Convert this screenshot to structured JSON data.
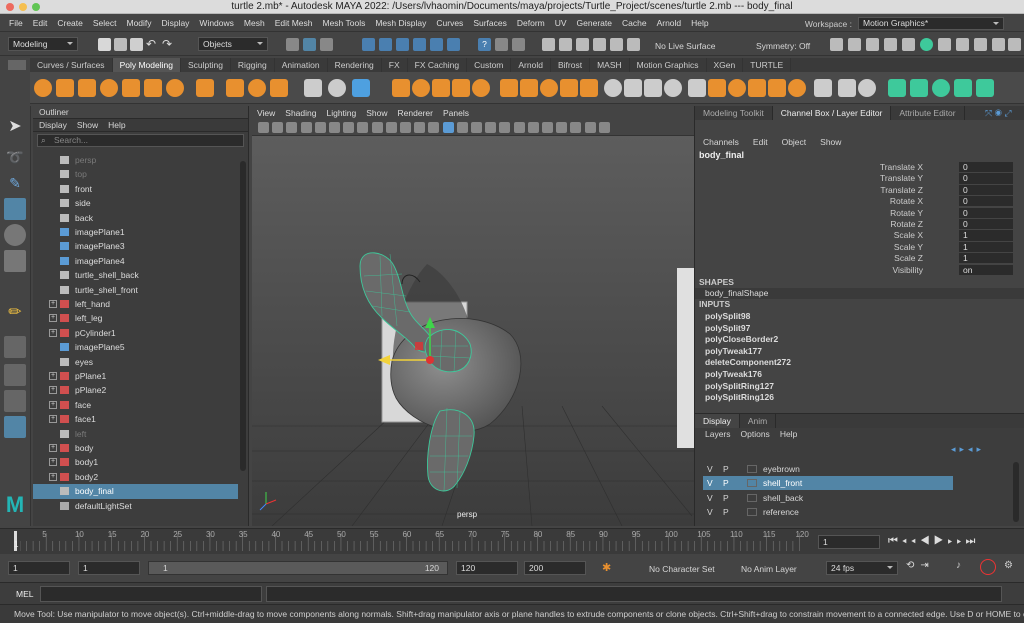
{
  "window": {
    "title": "turtle 2.mb* - Autodesk MAYA 2022: /Users/lvhaomin/Documents/maya/projects/Turtle_Project/scenes/turtle 2.mb   ---   body_final"
  },
  "menubar": [
    "File",
    "Edit",
    "Create",
    "Select",
    "Modify",
    "Display",
    "Windows",
    "Mesh",
    "Edit Mesh",
    "Mesh Tools",
    "Mesh Display",
    "Curves",
    "Surfaces",
    "Deform",
    "UV",
    "Generate",
    "Cache",
    "Arnold",
    "Help"
  ],
  "workspace": {
    "label": "Workspace :",
    "value": "Motion Graphics*"
  },
  "statusline": {
    "mode": "Modeling",
    "objects": "Objects",
    "live": "No Live Surface",
    "symmetry": "Symmetry: Off"
  },
  "shelf_tabs": [
    "Curves / Surfaces",
    "Poly Modeling",
    "Sculpting",
    "Rigging",
    "Animation",
    "Rendering",
    "FX",
    "FX Caching",
    "Custom",
    "Arnold",
    "Bifrost",
    "MASH",
    "Motion Graphics",
    "XGen",
    "TURTLE"
  ],
  "shelf_active": "Poly Modeling",
  "outliner": {
    "title": "Outliner",
    "menu": [
      "Display",
      "Show",
      "Help"
    ],
    "search_placeholder": "Search...",
    "items": [
      {
        "label": "persp",
        "icon": "camera",
        "dim": true
      },
      {
        "label": "top",
        "icon": "camera",
        "dim": true
      },
      {
        "label": "front",
        "icon": "camera"
      },
      {
        "label": "side",
        "icon": "camera"
      },
      {
        "label": "back",
        "icon": "camera"
      },
      {
        "label": "imagePlane1",
        "icon": "image-plane"
      },
      {
        "label": "imagePlane3",
        "icon": "image-plane"
      },
      {
        "label": "imagePlane4",
        "icon": "image-plane"
      },
      {
        "label": "turtle_shell_back",
        "icon": "transform"
      },
      {
        "label": "turtle_shell_front",
        "icon": "transform"
      },
      {
        "label": "left_hand",
        "icon": "mesh",
        "expand": true
      },
      {
        "label": "left_leg",
        "icon": "mesh",
        "expand": true
      },
      {
        "label": "pCylinder1",
        "icon": "mesh",
        "expand": true
      },
      {
        "label": "imagePlane5",
        "icon": "image-plane"
      },
      {
        "label": "eyes",
        "icon": "transform"
      },
      {
        "label": "pPlane1",
        "icon": "mesh",
        "expand": true
      },
      {
        "label": "pPlane2",
        "icon": "mesh",
        "expand": true
      },
      {
        "label": "face",
        "icon": "mesh",
        "expand": true
      },
      {
        "label": "face1",
        "icon": "mesh",
        "expand": true
      },
      {
        "label": "left",
        "icon": "camera",
        "dim": true
      },
      {
        "label": "body",
        "icon": "mesh",
        "expand": true
      },
      {
        "label": "body1",
        "icon": "mesh",
        "expand": true
      },
      {
        "label": "body2",
        "icon": "mesh",
        "expand": true
      },
      {
        "label": "body_final",
        "icon": "transform",
        "selected": true
      },
      {
        "label": "defaultLightSet",
        "icon": "set"
      }
    ]
  },
  "viewport": {
    "menu": [
      "View",
      "Shading",
      "Lighting",
      "Show",
      "Renderer",
      "Panels"
    ],
    "camera_label": "persp"
  },
  "right_tabs": [
    "Modeling Toolkit",
    "Channel Box / Layer Editor",
    "Attribute Editor"
  ],
  "channelbox": {
    "menu": [
      "Channels",
      "Edit",
      "Object",
      "Show"
    ],
    "object": "body_final",
    "channels": [
      {
        "name": "Translate X",
        "value": "0"
      },
      {
        "name": "Translate Y",
        "value": "0"
      },
      {
        "name": "Translate Z",
        "value": "0"
      },
      {
        "name": "Rotate X",
        "value": "0"
      },
      {
        "name": "Rotate Y",
        "value": "0"
      },
      {
        "name": "Rotate Z",
        "value": "0"
      },
      {
        "name": "Scale X",
        "value": "1"
      },
      {
        "name": "Scale Y",
        "value": "1"
      },
      {
        "name": "Scale Z",
        "value": "1"
      },
      {
        "name": "Visibility",
        "value": "on"
      }
    ],
    "shapes_header": "SHAPES",
    "shape": "body_finalShape",
    "inputs_header": "INPUTS",
    "inputs": [
      "polySplit98",
      "polySplit97",
      "polyCloseBorder2",
      "polyTweak177",
      "deleteComponent272",
      "polyTweak176",
      "polySplitRing127",
      "polySplitRing126"
    ]
  },
  "layer_editor": {
    "tabs": [
      "Display",
      "Anim"
    ],
    "menu": [
      "Layers",
      "Options",
      "Help"
    ],
    "layers": [
      {
        "v": "V",
        "p": "P",
        "name": "eyebrown"
      },
      {
        "v": "V",
        "p": "P",
        "name": "shell_front",
        "active": true
      },
      {
        "v": "V",
        "p": "P",
        "name": "shell_back"
      },
      {
        "v": "V",
        "p": "P",
        "name": "reference"
      }
    ]
  },
  "timeline": {
    "ticks": [
      "1",
      "5",
      "10",
      "15",
      "20",
      "25",
      "30",
      "35",
      "40",
      "45",
      "50",
      "55",
      "60",
      "65",
      "70",
      "75",
      "80",
      "85",
      "90",
      "95",
      "100",
      "105",
      "110",
      "115",
      "120"
    ],
    "current": "1"
  },
  "range": {
    "start": "1",
    "start2": "1",
    "slider_start": "1",
    "slider_end": "120",
    "end": "120",
    "end2": "200",
    "character": "No Character Set",
    "anim_layer": "No Anim Layer",
    "fps": "24 fps"
  },
  "mel": {
    "label": "MEL"
  },
  "help": "Move Tool: Use manipulator to move object(s). Ctrl+middle-drag to move components along normals. Shift+drag manipulator axis or plane handles to extrude components or clone objects. Ctrl+Shift+drag to constrain movement to a connected edge. Use D or HOME to change the pivot p",
  "colors": {
    "accent": "#5285a6",
    "wire": "#3ec99b",
    "orange": "#e8902f"
  }
}
